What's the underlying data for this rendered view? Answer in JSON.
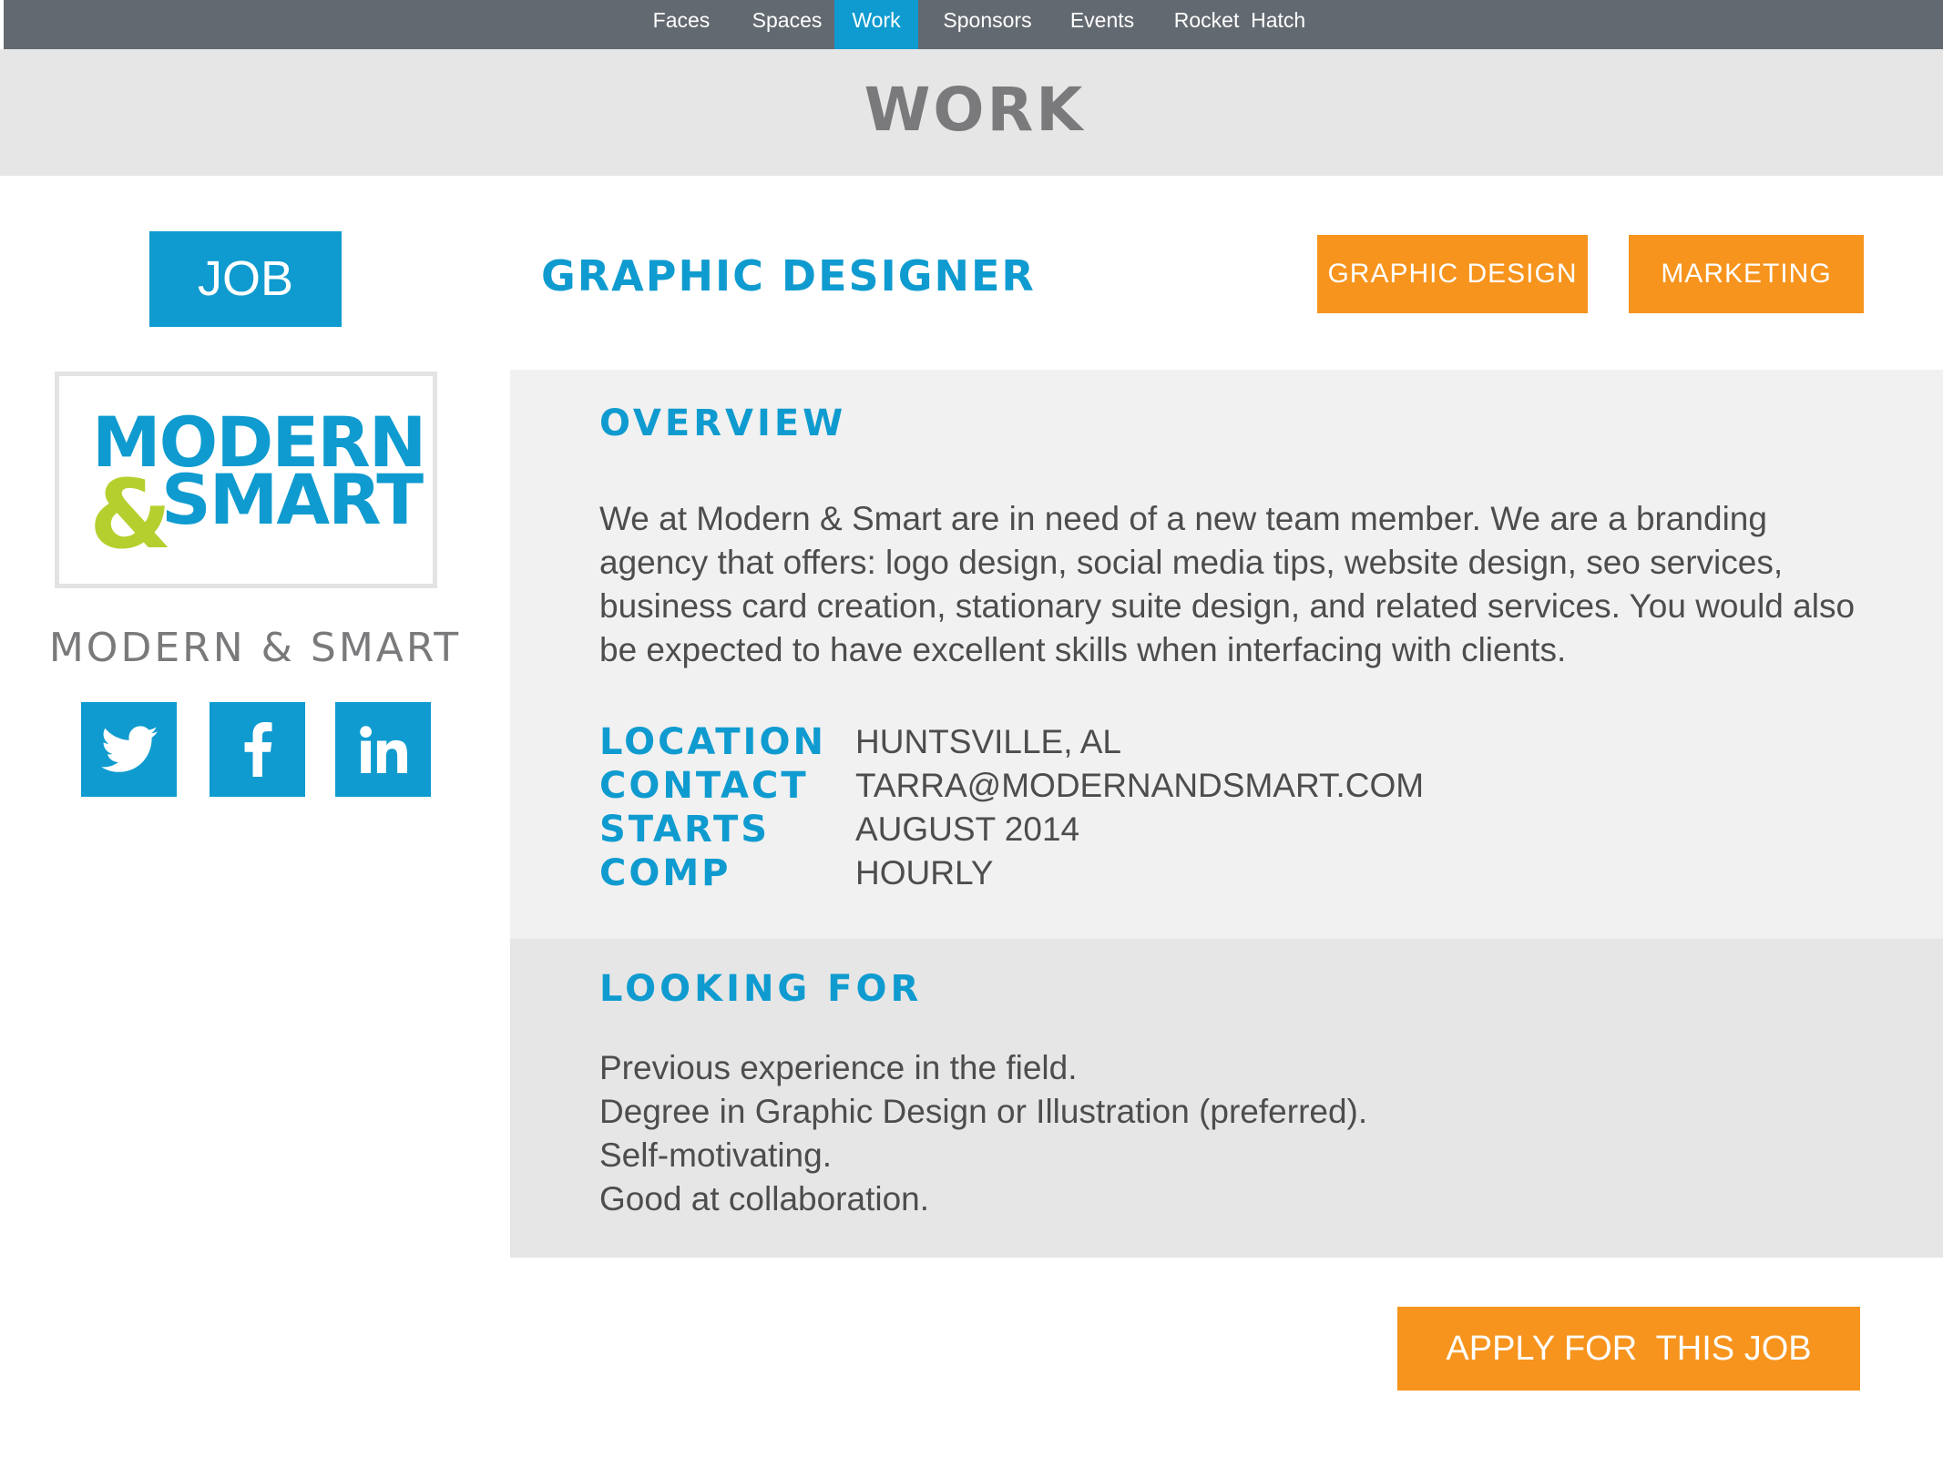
{
  "nav": {
    "items": [
      {
        "label": "Faces"
      },
      {
        "label": "Spaces"
      },
      {
        "label": "Work"
      },
      {
        "label": "Sponsors"
      },
      {
        "label": "Events"
      },
      {
        "label": "Rocket  Hatch"
      }
    ],
    "active": "Work"
  },
  "page": {
    "title": "WORK"
  },
  "sidebar": {
    "badge": "JOB",
    "logo": {
      "line1": "MODERN",
      "amp": "&",
      "line2": "SMART"
    },
    "company_name": "MODERN & SMART",
    "social_icons": [
      "twitter-icon",
      "facebook-icon",
      "linkedin-icon"
    ]
  },
  "job": {
    "title": "GRAPHIC DESIGNER",
    "tags": [
      "GRAPHIC DESIGN",
      "MARKETING"
    ]
  },
  "overview": {
    "heading": "OVERVIEW",
    "text": "We at Modern & Smart are in need of a new team member. We are a branding agency that offers: logo design, social media tips, website design, seo services, business card creation, stationary suite design, and related services. You would also be expected to have excellent skills when interfacing with clients.",
    "details": [
      {
        "label": "LOCATION",
        "value": "HUNTSVILLE, AL"
      },
      {
        "label": "CONTACT",
        "value": "TARRA@MODERNANDSMART.COM"
      },
      {
        "label": "STARTS",
        "value": "AUGUST 2014"
      },
      {
        "label": "COMP",
        "value": "HOURLY"
      }
    ]
  },
  "looking_for": {
    "heading": "LOOKING FOR",
    "items": [
      "Previous experience in the field.",
      "Degree in Graphic Design or Illustration (preferred).",
      "Self-motivating.",
      "Good at collaboration."
    ]
  },
  "apply_button": "APPLY FOR  THIS JOB",
  "colors": {
    "accent_blue": "#0f9bcf",
    "accent_orange": "#f7941d",
    "logo_green": "#b5cf2e",
    "nav_bg": "#636970"
  }
}
